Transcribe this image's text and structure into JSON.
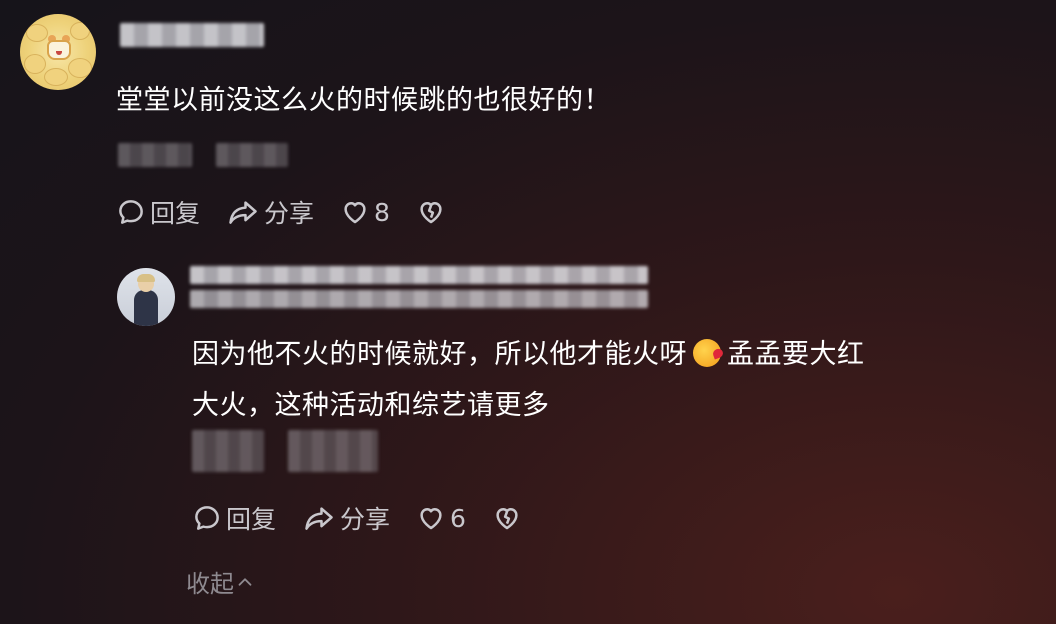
{
  "comments": [
    {
      "text": "堂堂以前没这么火的时候跳的也很好的！",
      "actions": {
        "reply": "回复",
        "share": "分享",
        "likes": "8"
      }
    },
    {
      "text_line1": "因为他不火的时候就好，所以他才能火呀",
      "text_line1_tail": "孟孟要大红",
      "text_line2": "大火，这种活动和综艺请更多",
      "actions": {
        "reply": "回复",
        "share": "分享",
        "likes": "6"
      }
    }
  ],
  "collapse_label": "收起",
  "icons": {
    "reply": "comment-bubble-icon",
    "share": "share-arrow-icon",
    "like": "heart-icon",
    "dislike": "broken-heart-icon",
    "collapse": "chevron-up-icon"
  },
  "colors": {
    "text": "#ffffff",
    "muted": "#c9c7cc",
    "collapse": "#8e8a90"
  }
}
